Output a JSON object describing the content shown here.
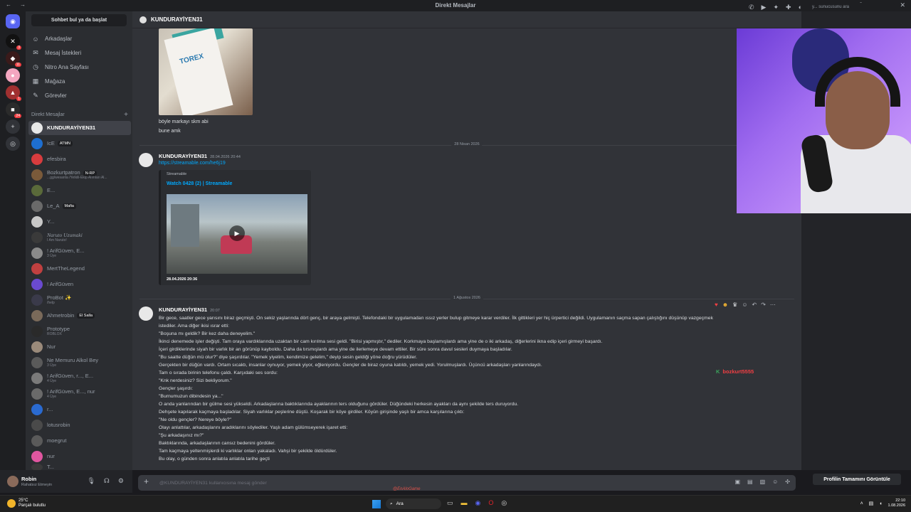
{
  "window": {
    "title": "Direkt Mesajlar"
  },
  "servers": [
    {
      "icon": "discord-icon",
      "label": "",
      "badge": ""
    },
    {
      "icon": "server-icon",
      "label": "",
      "badge": "3"
    },
    {
      "icon": "server-icon",
      "label": "",
      "badge": "11"
    },
    {
      "icon": "server-icon",
      "label": "",
      "badge": ""
    },
    {
      "icon": "server-icon",
      "label": "",
      "badge": "1"
    },
    {
      "icon": "server-icon",
      "label": "",
      "badge": "24"
    }
  ],
  "sidebar": {
    "search_label": "Sohbet bul ya da başlat",
    "nav": [
      "Arkadaşlar",
      "Mesaj İstekleri",
      "Nitro Ana Sayfası",
      "Mağaza",
      "Görevler"
    ],
    "dm_header": "Direkt Mesajlar",
    "dms": [
      {
        "name": "KUNDURAYİYEN31",
        "sub": "",
        "tag": ""
      },
      {
        "name": "IcE",
        "sub": "",
        "tag": "ATMN"
      },
      {
        "name": "efesbira",
        "sub": "",
        "tag": ""
      },
      {
        "name": "Bozkurtpatron",
        "sub": "...gg/wesanta /Yetkili-Ekip Alımları Al...",
        "tag": "N-RP"
      },
      {
        "name": "E...",
        "sub": "",
        "tag": ""
      },
      {
        "name": "Le_A",
        "sub": "",
        "tag": "Mafia"
      },
      {
        "name": "Y...",
        "sub": "",
        "tag": ""
      },
      {
        "name": "Naruto Uzumaki",
        "sub": "I Am Naruto!",
        "tag": ""
      },
      {
        "name": "! ArifGüven, E...",
        "sub": "3 Üye",
        "tag": ""
      },
      {
        "name": "MertTheLegend",
        "sub": "",
        "tag": ""
      },
      {
        "name": "! ArifGüven",
        "sub": "",
        "tag": ""
      },
      {
        "name": "ProBot ✨",
        "sub": "/help",
        "tag": ""
      },
      {
        "name": "Ahmetrobin",
        "sub": "",
        "tag": "El Salla"
      },
      {
        "name": "Prototype",
        "sub": "ROBLOX",
        "tag": ""
      },
      {
        "name": "Nur",
        "sub": "",
        "tag": ""
      },
      {
        "name": "Ne Memuru Alkol Bey",
        "sub": "3 Üye",
        "tag": ""
      },
      {
        "name": "! ArifGüven, r..., E...",
        "sub": "4 Üye",
        "tag": ""
      },
      {
        "name": "! ArifGüven, E..., nur",
        "sub": "4 Üye",
        "tag": ""
      },
      {
        "name": "r...",
        "sub": "",
        "tag": ""
      },
      {
        "name": "lotusrobin",
        "sub": "",
        "tag": ""
      },
      {
        "name": "moegrut",
        "sub": "",
        "tag": ""
      },
      {
        "name": "nur",
        "sub": "",
        "tag": ""
      },
      {
        "name": "T...",
        "sub": "",
        "tag": ""
      }
    ]
  },
  "user": {
    "name": "Robin",
    "status": "Rahatsız Etmeyin"
  },
  "chat": {
    "header_name": "KUNDURAYİYEN31",
    "search_placeholder": "y... sunucusunu ara",
    "image_text": "TOREX",
    "first_lines": [
      "böyle markayı skm abi",
      "bune amk"
    ],
    "divider1": "28 Nisan 2026",
    "msg2": {
      "author": "KUNDURAYİYEN31",
      "time": "28.04.2026 20:44",
      "link": "https://streamable.com/he6j19",
      "embed_provider": "Streamable",
      "embed_title": "Watch 0428 (2) | Streamable",
      "video_date": "28.04.2026 20:36"
    },
    "divider2": "1 Ağustos 2026",
    "msg3": {
      "author": "KUNDURAYİYEN31",
      "time": "20:07",
      "lines": [
        "Bir gece, saatler gece yarısını biraz geçmişti. On sekiz yaşlarında dört genç, bir araya gelmişti. Telefondaki bir uygulamadan ıssız yerler bulup gitmeye karar verdiler. İlk gittikleri yer hiç ürpertici değildi. Uygulamanın saçma sapan çalıştığını düşünüp vazgeçmek",
        "istediler. Ama diğer ikisi ısrar etti:",
        "\"Boşuna mı geldik? Bir kez daha deneyelim.\"",
        "İkinci denemede işler değişti. Tam oraya vardıklarında uzaktan bir cam kırılma sesi geldi. \"Birisi yapmıştır,\" dediler. Korkmaya başlamışlardı ama yine de o iki arkadaş, diğerlerini ikna edip içeri girmeyi başardı.",
        "İçeri girdiklerinde siyah bir varlık bir an görünüp kayboldu. Daha da tırsmışlardı ama yine de ilerlemeye devam ettiler. Bir süre sonra davul sesleri duymaya başladılar.",
        "\"Bu saatte düğün mü olur?\" diye şaşırdılar. \"Yemek yiyelim, kendimize gelelim,\" deyip sesin geldiği yöne doğru yürüdüler.",
        "Gerçekten bir düğün vardı. Ortam sıcaktı, insanlar oynuyor, yemek yiyor, eğleniyordu. Gençler de biraz oyuna katıldı, yemek yedi. Yorulmuşlardı. Üçüncü arkadaşları yanlarındaydı.",
        "Tam o sırada birinin telefonu çaldı. Karşıdaki ses sordu:",
        "\"Knk nerdesiniz? Sizi bekliyorum.\"",
        "Gençler şaşırdı:",
        "\"Burnumuzun dibindesin ya...\"",
        "O anda yanlarından bir gülme sesi yükseldi. Arkadaşlarına baktıklarında ayaklarının ters olduğunu gördüler. Düğündeki herkesin ayakları da aynı şekilde ters duruyordu.",
        "Dehşete kapılarak kaçmaya başladılar. Siyah varlıklar peşlerine düştü. Koşarak bir köye girdiler. Köyün girişinde yaşlı bir amca karşılarına çıktı:",
        "\"Ne oldu gençler? Nereye böyle?\"",
        "Olayı anlattılar, arkadaşlarını aradıklarını söylediler. Yaşlı adam gülümseyerek işaret etti:",
        "\"Şu arkadaşınız mı?\"",
        "Baktıklarında, arkadaşlarının cansız bedenini gördüler.",
        "Tam kaçmaya yeltenmişlerdi ki varlıklar onları yakaladı. Vahşi bir şekilde öldürdüler.",
        "Bu olay, o günden sonra anlatıla anlatıla tarihe geçti"
      ]
    },
    "overlay_user": "bozkurt5555",
    "composer_placeholder": "@KUNDURAYİYEN31 kullanıcısına mesaj gönder"
  },
  "right_panel": {
    "full_profile_label": "Profilin Tamamını Görüntüle"
  },
  "taskbar": {
    "temp": "25°C",
    "weather": "Parçalı bulutlu",
    "search": "Ara",
    "time": "22:10",
    "date": "1.08.2026"
  },
  "watermark": "@EnAloGame",
  "colors": {
    "accent": "#5865f2",
    "link": "#00a8fc",
    "dnd": "#f23f43",
    "bg_chat": "#313338",
    "bg_side": "#2b2d31"
  }
}
